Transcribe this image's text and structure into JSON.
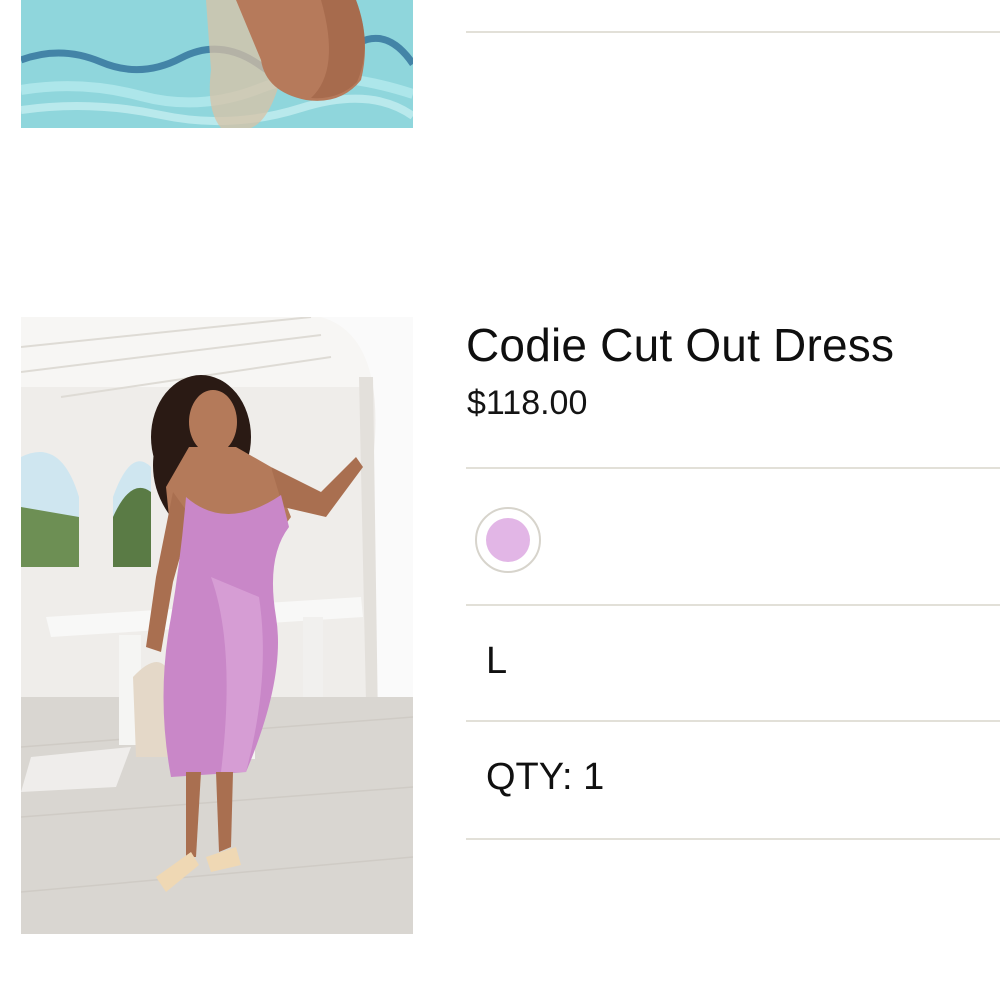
{
  "previous_item": {
    "image_alt": "person in swimming pool",
    "pool_color": "#8fd6dc"
  },
  "cart_item": {
    "image_alt": "Woman wearing lilac satin cut out dress",
    "name": "Codie Cut Out Dress",
    "price": "$118.00",
    "color_swatch": {
      "color": "#e2b6e6",
      "selected": true
    },
    "size": "L",
    "quantity": {
      "label": "QTY:",
      "value": "1"
    }
  },
  "colors": {
    "divider": "#e2e0d8",
    "text": "#111111"
  }
}
